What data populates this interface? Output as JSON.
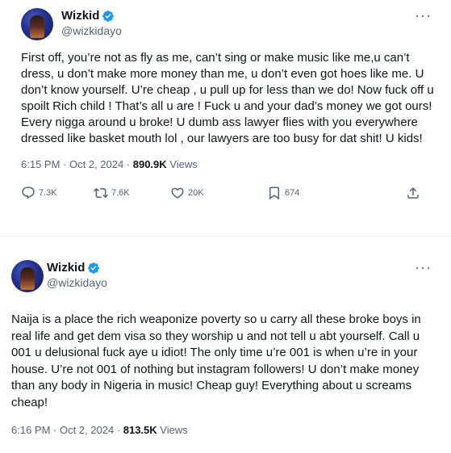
{
  "tweets": [
    {
      "display_name": "Wizkid",
      "handle": "@wizkidayo",
      "text": "First off, you’re not as fly as me, can’t sing or make music like me,u can’t dress, u don’t make more money than me, u don’t even got hoes like me. U don’t know yourself. U’re cheap , u pull up for less than we do! Now fuck off u spoilt Rich child ! That’s all u are ! Fuck u and your dad’s money we got ours! Every nigga around u broke! U dumb ass lawyer flies with you everywhere dressed like basket mouth lol , our lawyers are too busy for dat shit! U kids!",
      "time": "6:15 PM · Oct 2, 2024 · ",
      "views_count": "890.9K",
      "views_label": " Views",
      "replies": "7.3K",
      "reposts": "7.6K",
      "likes": "20K",
      "bookmarks": "674"
    },
    {
      "display_name": "Wizkid",
      "handle": "@wizkidayo",
      "text": "Naija is a place the rich weaponize poverty so u carry all these broke boys in real life and get dem visa so they worship u and not tell u abt yourself. Call u 001 u delusional fuck aye u idiot! The only time u’re 001 is when u’re in your house. U’re not 001 of nothing but instagram followers! U don’t make money than any body in Nigeria in music! Cheap guy! Everything about u screams cheap!",
      "time": "6:16 PM · Oct 2, 2024 · ",
      "views_count": "813.5K",
      "views_label": " Views"
    }
  ],
  "colors": {
    "text": "#0f1419",
    "secondary": "#536471",
    "verified": "#1d9bf0"
  }
}
